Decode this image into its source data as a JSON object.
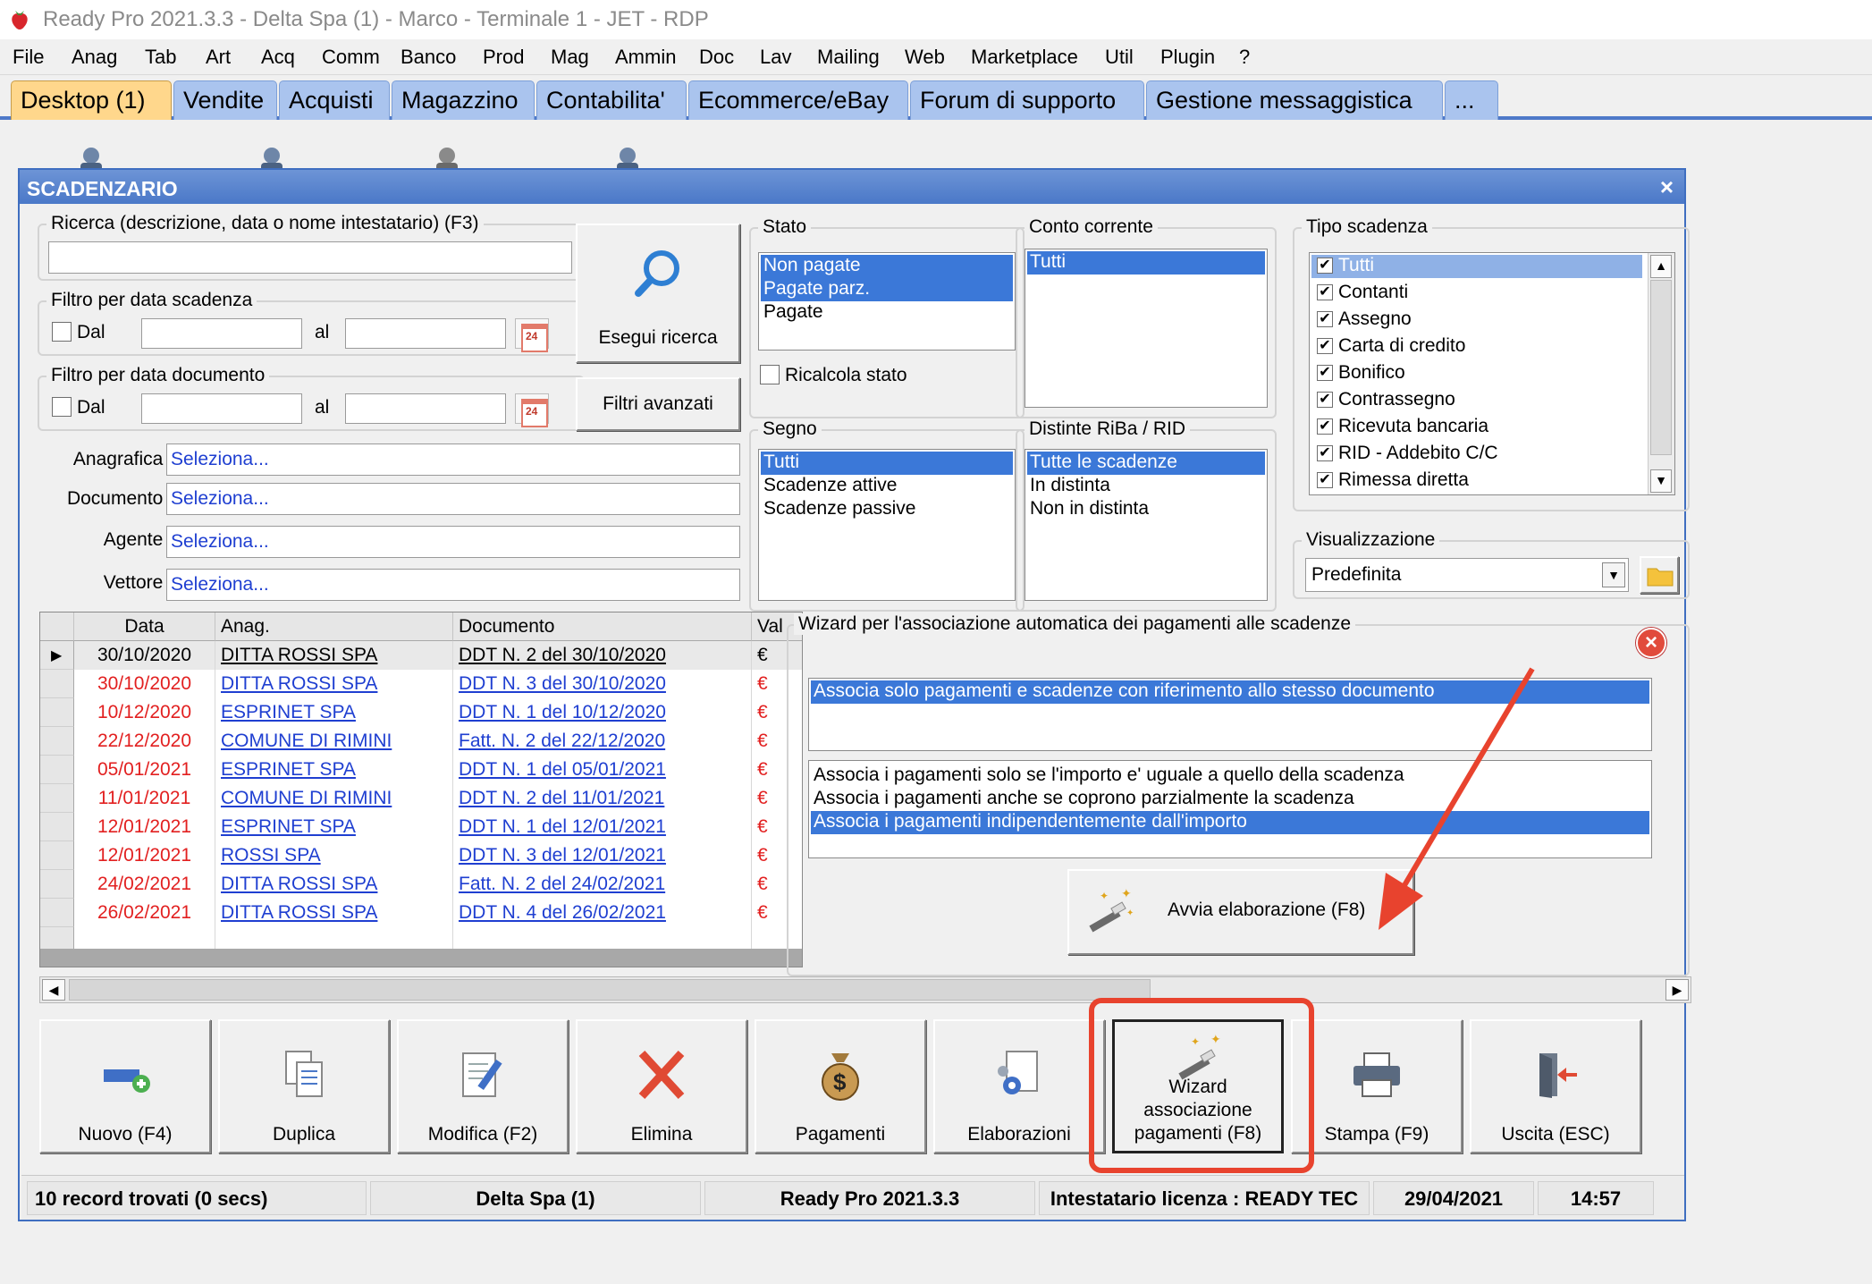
{
  "window": {
    "title": "Ready Pro 2021.3.3 - Delta Spa (1) - Marco - Terminale 1 - JET - RDP"
  },
  "menu": [
    "File",
    "Anag",
    "Tab",
    "Art",
    "Acq",
    "Comm",
    "Banco",
    "Prod",
    "Mag",
    "Ammin",
    "Doc",
    "Lav",
    "Mailing",
    "Web",
    "Marketplace",
    "Util",
    "Plugin",
    "?"
  ],
  "tabs": [
    "Desktop (1)",
    "Vendite",
    "Acquisti",
    "Magazzino",
    "Contabilita'",
    "Ecommerce/eBay",
    "Forum di supporto",
    "Gestione messaggistica",
    "..."
  ],
  "dialog": {
    "title": "SCADENZARIO",
    "close": "×",
    "search": {
      "label": "Ricerca (descrizione, data o nome intestatario) (F3)",
      "value": "",
      "button": "Esegui ricerca",
      "advanced": "Filtri avanzati"
    },
    "due_date_filter": {
      "label": "Filtro per data scadenza",
      "from": "Dal",
      "to": "al",
      "cal": "24"
    },
    "doc_date_filter": {
      "label": "Filtro per data documento",
      "from": "Dal",
      "to": "al",
      "cal": "24"
    },
    "fields": {
      "anagrafica_label": "Anagrafica :",
      "anagrafica_value": "Seleziona...",
      "documento_label": "Documento :",
      "documento_value": "Seleziona...",
      "agente_label": "Agente :",
      "agente_value": "Seleziona...",
      "vettore_label": "Vettore :",
      "vettore_value": "Seleziona..."
    },
    "stato": {
      "label": "Stato",
      "items": [
        "Non pagate",
        "Pagate parz.",
        "Pagate"
      ],
      "recalc": "Ricalcola stato"
    },
    "conto": {
      "label": "Conto corrente",
      "items": [
        "Tutti"
      ]
    },
    "segno": {
      "label": "Segno",
      "items": [
        "Tutti",
        "Scadenze attive",
        "Scadenze passive"
      ]
    },
    "distinte": {
      "label": "Distinte RiBa / RID",
      "items": [
        "Tutte le scadenze",
        "In distinta",
        "Non in distinta"
      ]
    },
    "tipo": {
      "label": "Tipo scadenza",
      "items": [
        "Tutti",
        "Contanti",
        "Assegno",
        "Carta di credito",
        "Bonifico",
        "Contrassegno",
        "Ricevuta bancaria",
        "RID - Addebito C/C",
        "Rimessa diretta"
      ]
    },
    "visualizzazione": {
      "label": "Visualizzazione",
      "value": "Predefinita"
    },
    "grid": {
      "headers": [
        "Data",
        "Anag.",
        "Documento",
        "Val"
      ],
      "rows": [
        {
          "data": "30/10/2020",
          "anag": "DITTA ROSSI SPA",
          "doc": "DDT N. 2 del 30/10/2020",
          "val": "€"
        },
        {
          "data": "30/10/2020",
          "anag": "DITTA ROSSI SPA",
          "doc": "DDT N. 3 del 30/10/2020",
          "val": "€"
        },
        {
          "data": "10/12/2020",
          "anag": "ESPRINET SPA",
          "doc": "DDT N. 1 del 10/12/2020",
          "val": "€"
        },
        {
          "data": "22/12/2020",
          "anag": "COMUNE DI RIMINI",
          "doc": "Fatt. N. 2 del 22/12/2020",
          "val": "€"
        },
        {
          "data": "05/01/2021",
          "anag": "ESPRINET SPA",
          "doc": "DDT N. 1 del 05/01/2021",
          "val": "€"
        },
        {
          "data": "11/01/2021",
          "anag": "COMUNE DI RIMINI",
          "doc": "DDT N. 2 del 11/01/2021",
          "val": "€"
        },
        {
          "data": "12/01/2021",
          "anag": "ESPRINET SPA",
          "doc": "DDT N. 1 del 12/01/2021",
          "val": "€"
        },
        {
          "data": "12/01/2021",
          "anag": "ROSSI SPA",
          "doc": "DDT N. 3 del 12/01/2021",
          "val": "€"
        },
        {
          "data": "24/02/2021",
          "anag": "DITTA ROSSI SPA",
          "doc": "Fatt. N. 2 del 24/02/2021",
          "val": "€"
        },
        {
          "data": "26/02/2021",
          "anag": "DITTA ROSSI SPA",
          "doc": "DDT N. 4 del 26/02/2021",
          "val": "€"
        }
      ]
    },
    "wizard": {
      "label": "Wizard per l'associazione automatica dei pagamenti alle scadenze",
      "list1": [
        "Associa solo pagamenti e scadenze con riferimento allo stesso documento"
      ],
      "list2": [
        "Associa i pagamenti solo se l'importo e' uguale a quello della scadenza",
        "Associa i pagamenti anche se coprono parzialmente la scadenza",
        "Associa i pagamenti indipendentemente dall'importo"
      ],
      "run": "Avvia elaborazione (F8)"
    },
    "buttons": [
      "Nuovo (F4)",
      "Duplica",
      "Modifica (F2)",
      "Elimina",
      "Pagamenti",
      "Elaborazioni",
      "Wizard associazione pagamenti (F8)",
      "Stampa (F9)",
      "Uscita (ESC)"
    ],
    "status": [
      "10 record trovati (0 secs)",
      "Delta Spa (1)",
      "Ready Pro 2021.3.3",
      "Intestatario licenza : READY TEC",
      "29/04/2021",
      "14:57"
    ]
  },
  "colors": {
    "selection": "#3b78d8",
    "tab_active": "#ffd78c",
    "tab": "#aac4ee",
    "annotation": "#e8432e",
    "link": "#1f3fd1",
    "overdue": "#e22020"
  }
}
